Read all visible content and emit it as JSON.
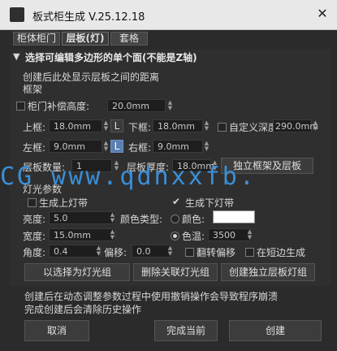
{
  "window": {
    "title": "板式柜生成 V.25.12.18",
    "close": "✕"
  },
  "tabs": [
    {
      "label": "柜体柜门"
    },
    {
      "label": "层板(灯)"
    },
    {
      "label": "套格"
    }
  ],
  "section_header": "选择可编辑多边形的单个面(不能是Z轴)",
  "info_line": "创建后此处显示层板之间的距离",
  "frame": {
    "group_label": "框架",
    "door_comp": {
      "label": "柜门补偿高度:",
      "value": "20.0mm"
    },
    "top": {
      "label": "上框:",
      "value": "18.0mm"
    },
    "bottom": {
      "label": "下框:",
      "value": "18.0mm"
    },
    "custom_depth": {
      "label": "自定义深度:",
      "value": "290.0mm"
    },
    "left": {
      "label": "左框:",
      "value": "9.0mm"
    },
    "right": {
      "label": "右框:",
      "value": "9.0mm"
    },
    "L_button": "L",
    "shelf_count": {
      "label": "层板数量:",
      "value": "1"
    },
    "shelf_thick": {
      "label": "层板厚度:",
      "value": "18.0mm"
    },
    "independent_btn": "独立框架及层板"
  },
  "light": {
    "group_label": "灯光参数",
    "gen_top": "生成上灯带",
    "gen_bottom": "生成下灯带",
    "brightness": {
      "label": "亮度:",
      "value": "5.0"
    },
    "color_type": "颜色类型:",
    "color_opt": "颜色:",
    "color_swatch": "#ffffff",
    "width": {
      "label": "宽度:",
      "value": "15.0mm"
    },
    "temp_opt": "色温:",
    "temp_value": "3500",
    "angle": {
      "label": "角度:",
      "value": "0.4"
    },
    "offset": {
      "label": "偏移:",
      "value": "0.0"
    },
    "flip": "翻转偏移",
    "short_edge": "在短边生成",
    "btn_select": "以选择为灯光组",
    "btn_delete": "删除关联灯光组",
    "btn_create": "创建独立层板灯组"
  },
  "notes": [
    "创建后在动态调整参数过程中使用撤销操作会导致程序崩溃",
    "完成创建后会清除历史操作"
  ],
  "footer": {
    "cancel": "取消",
    "finish": "完成当前",
    "create": "创建"
  },
  "watermark": "CG www.qdnxxfb.",
  "accent": "#3a8fd8"
}
